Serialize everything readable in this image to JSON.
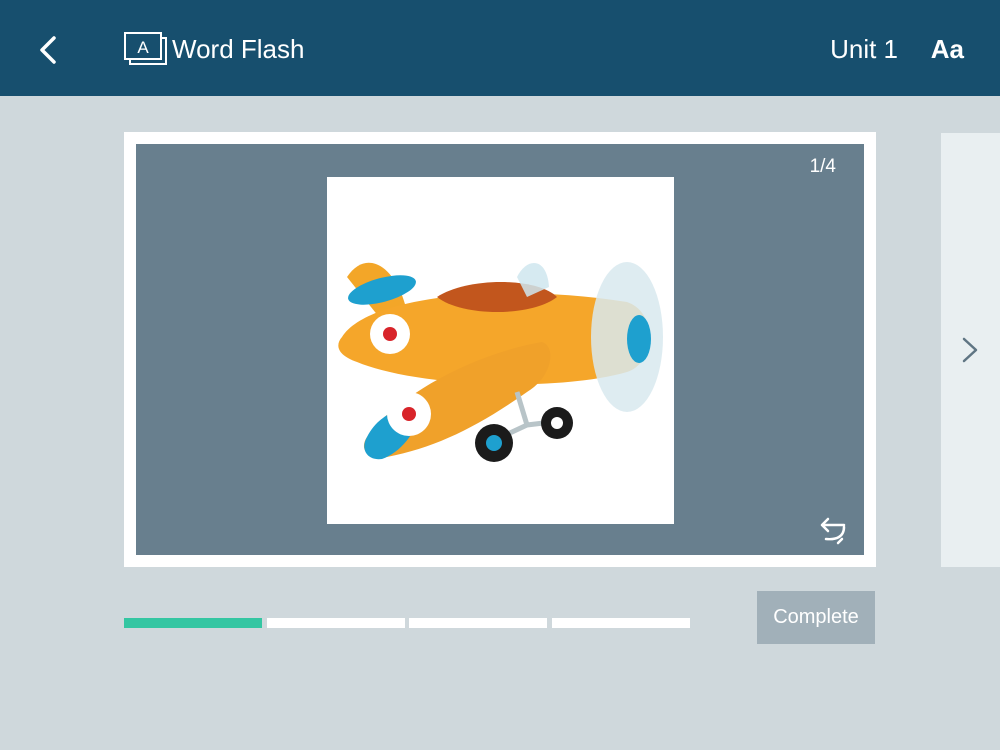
{
  "header": {
    "title": "Word Flash",
    "unit": "Unit 1",
    "font_toggle": "Aa"
  },
  "card": {
    "counter": "1/4",
    "image": "airplane-illustration"
  },
  "progress": {
    "total": 4,
    "current": 1
  },
  "actions": {
    "complete_label": "Complete"
  },
  "colors": {
    "header_bg": "#174f6e",
    "page_bg": "#cfd8dc",
    "card_inner": "#687f8e",
    "progress_active": "#34c6a2",
    "complete_bg": "#a1b0b9"
  }
}
